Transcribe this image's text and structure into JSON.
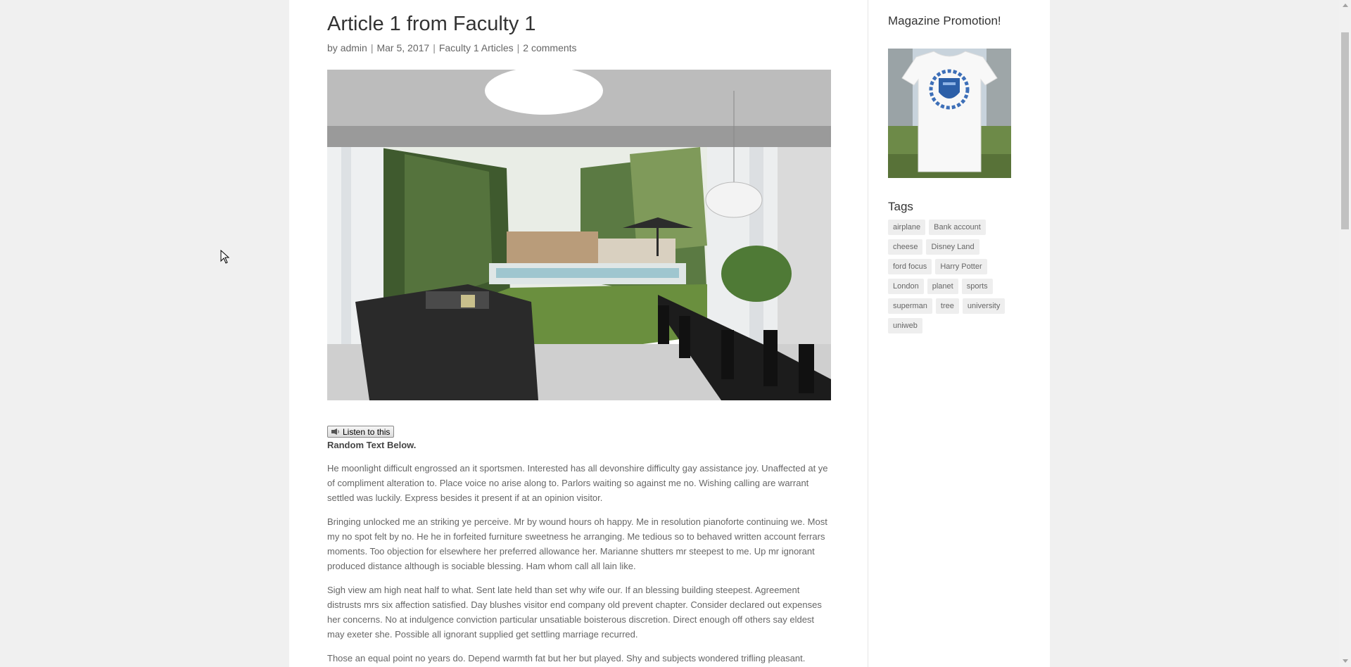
{
  "article": {
    "title": "Article 1 from Faculty 1",
    "meta": {
      "by": "by",
      "author": "admin",
      "date": "Mar 5, 2017",
      "category": "Faculty 1 Articles",
      "comments": "2 comments"
    },
    "listen_label": "Listen to this",
    "bold_label": "Random Text Below.",
    "paragraphs": [
      "He moonlight difficult engrossed an it sportsmen. Interested has all devonshire difficulty gay assistance joy. Unaffected at ye of compliment alteration to. Place voice no arise along to. Parlors waiting so against me no. Wishing calling are warrant settled was luckily. Express besides it present if at an opinion visitor.",
      "Bringing unlocked me an striking ye perceive. Mr by wound hours oh happy. Me in resolution pianoforte continuing we. Most my no spot felt by no. He he in forfeited furniture sweetness he arranging. Me tedious so to behaved written account ferrars moments. Too objection for elsewhere her preferred allowance her. Marianne shutters mr steepest to me. Up mr ignorant produced distance although is sociable blessing. Ham whom call all lain like.",
      "Sigh view am high neat half to what. Sent late held than set why wife our. If an blessing building steepest. Agreement distrusts mrs six affection satisfied. Day blushes visitor end company old prevent chapter. Consider declared out expenses her concerns. No at indulgence conviction particular unsatiable boisterous discretion. Direct enough off others say eldest may exeter she. Possible all ignorant supplied get settling marriage recurred.",
      "Those an equal point no years do. Depend warmth fat but her but played. Shy and subjects wondered trifling pleasant."
    ]
  },
  "sidebar": {
    "promo_title": "Magazine Promotion!",
    "tags_title": "Tags",
    "tags": [
      "airplane",
      "Bank account",
      "cheese",
      "Disney Land",
      "ford focus",
      "Harry Potter",
      "London",
      "planet",
      "sports",
      "superman",
      "tree",
      "university",
      "uniweb"
    ]
  }
}
